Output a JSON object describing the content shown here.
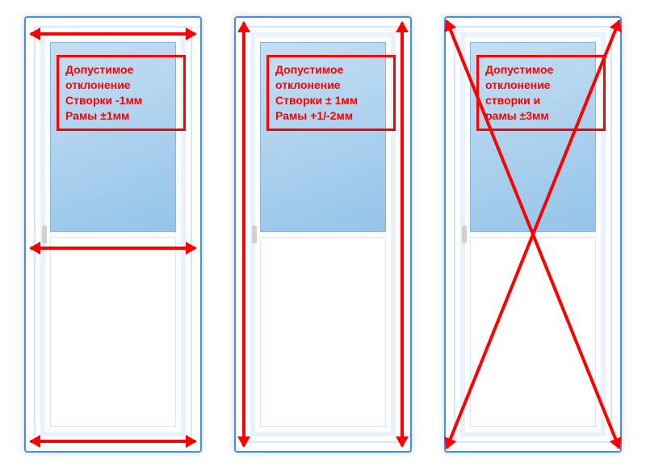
{
  "doors": [
    {
      "label_lines": [
        "Допустимое",
        "отклонение",
        "Створки -1мм",
        "Рамы ±1мм"
      ],
      "measurements": "horizontal-three"
    },
    {
      "label_lines": [
        "Допустимое",
        "отклонение",
        "Створки ± 1мм",
        "Рамы +1/-2мм"
      ],
      "measurements": "vertical-two"
    },
    {
      "label_lines": [
        "Допустимое",
        "отклонение",
        "створки и",
        "рамы  ±3мм"
      ],
      "measurements": "diagonal-cross"
    }
  ]
}
